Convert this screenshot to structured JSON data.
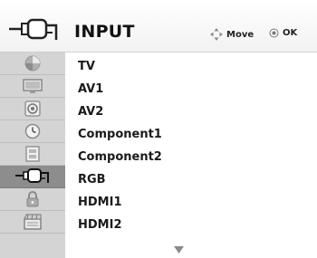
{
  "header": {
    "title": "INPUT",
    "move_label": "Move",
    "ok_label": "OK"
  },
  "sidebar": {
    "items": [
      {
        "icon": "picture-icon",
        "active": false
      },
      {
        "icon": "screen-icon",
        "active": false
      },
      {
        "icon": "audio-icon",
        "active": false
      },
      {
        "icon": "time-icon",
        "active": false
      },
      {
        "icon": "option-icon",
        "active": false
      },
      {
        "icon": "input-plug-icon",
        "active": true
      },
      {
        "icon": "lock-icon",
        "active": false
      },
      {
        "icon": "usb-movie-icon",
        "active": false
      }
    ]
  },
  "inputs": [
    "TV",
    "AV1",
    "AV2",
    "Component1",
    "Component2",
    "RGB",
    "HDMI1",
    "HDMI2"
  ],
  "colors": {
    "sidebar_bg": "#d4d4d4",
    "sidebar_active": "#8d8d8d",
    "text": "#1a1a1a"
  }
}
